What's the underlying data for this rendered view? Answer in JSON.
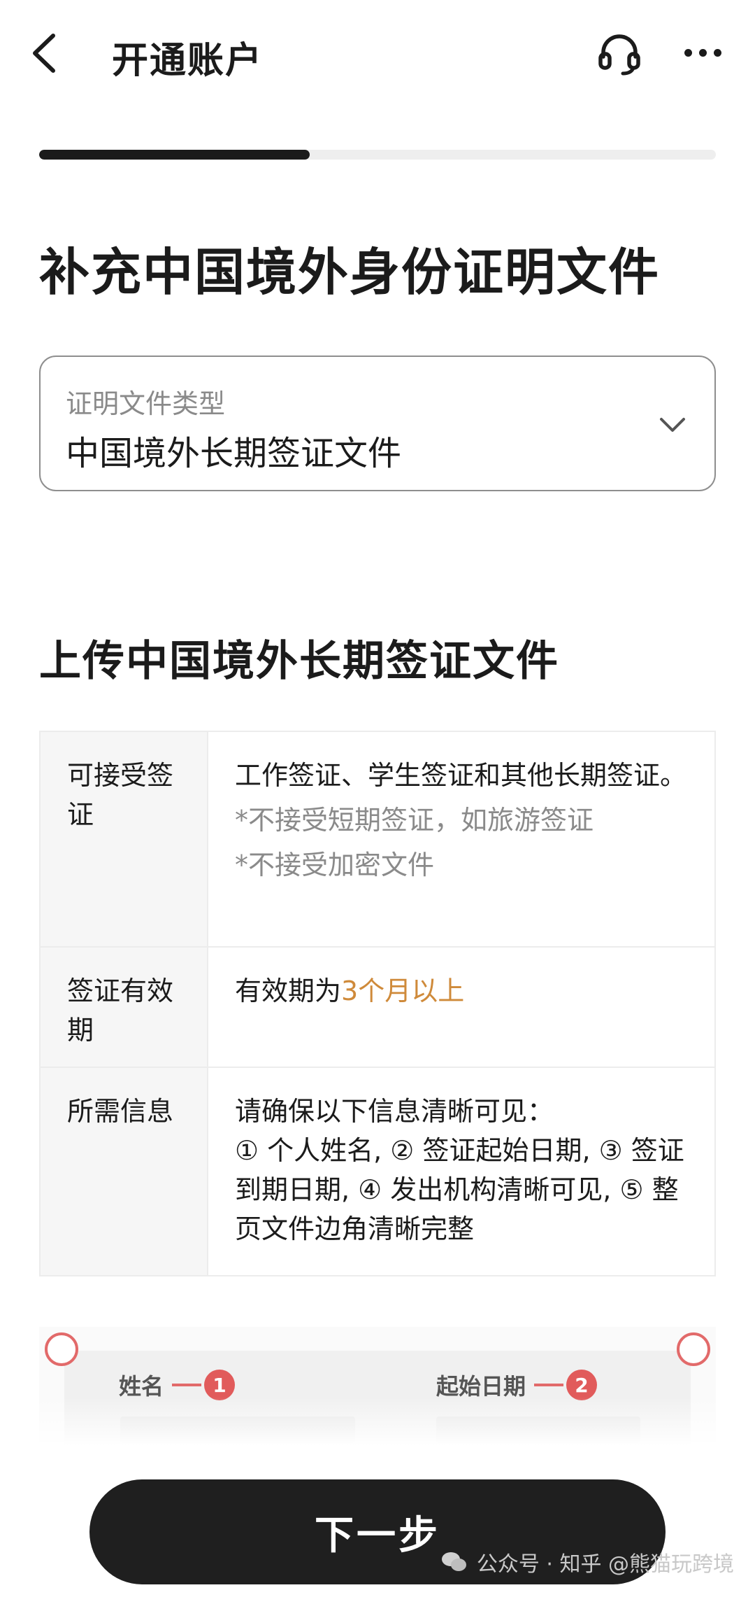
{
  "header": {
    "title": "开通账户",
    "back_icon": "chevron-left-icon",
    "support_icon": "headset-icon",
    "more_icon": "more-horizontal-icon"
  },
  "progress": {
    "fraction": 0.4
  },
  "page_title": "补充中国境外身份证明文件",
  "document_type": {
    "label": "证明文件类型",
    "value": "中国境外长期签证文件"
  },
  "upload_section": {
    "title": "上传中国境外长期签证文件"
  },
  "info_table": {
    "rows": [
      {
        "key": "可接受签证",
        "value": "工作签证、学生签证和其他长期签证。",
        "notes": [
          "*不接受短期签证，如旅游签证",
          "*不接受加密文件"
        ]
      },
      {
        "key": "签证有效期",
        "value_prefix": "有效期为",
        "value_highlight": "3个月以上"
      },
      {
        "key": "所需信息",
        "value_line1": "请确保以下信息清晰可见：",
        "value_line2": "① 个人姓名, ② 签证起始日期, ③ 签证到期日期, ④ 发出机构清晰可见, ⑤ 整页文件边角清晰完整"
      }
    ]
  },
  "sample": {
    "field1_label": "姓名",
    "field1_num": "1",
    "field2_label": "起始日期",
    "field2_num": "2"
  },
  "next_button": "下一步",
  "watermark": "公众号 · 知乎 @熊猫玩跨境",
  "colors": {
    "primary": "#1f1f1f",
    "highlight": "#cf8a3a",
    "marker": "#e15b5b"
  }
}
